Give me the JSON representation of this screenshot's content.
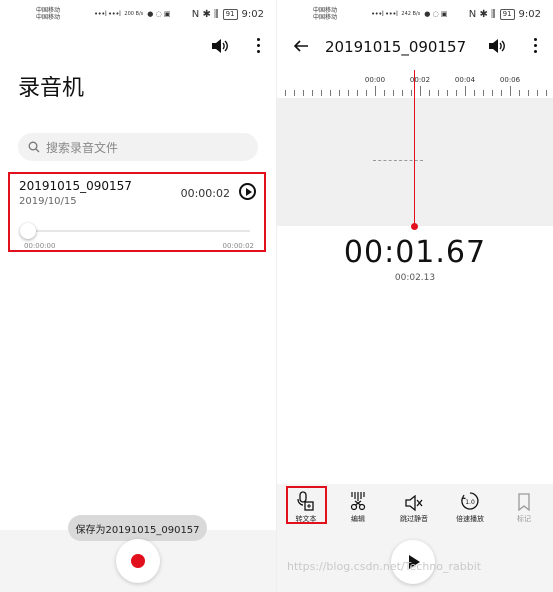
{
  "status_left": {
    "carrier_line1": "中国移动",
    "carrier_line2": "中国移动",
    "signal": "•••l •••l",
    "speed": "200 B/s",
    "time": "9:02",
    "battery": "91"
  },
  "status_right": {
    "carrier_line1": "中国移动",
    "carrier_line2": "中国移动",
    "signal": "•••l •••l",
    "speed": "242 B/s",
    "time": "9:02",
    "battery": "91"
  },
  "left": {
    "title": "录音机",
    "search_placeholder": "搜索录音文件",
    "recording": {
      "name": "20191015_090157",
      "date": "2019/10/15",
      "duration": "00:00:02",
      "time_start": "00:00:00",
      "time_end": "00:00:02",
      "progress": 0
    },
    "toast": "保存为20191015_090157"
  },
  "right": {
    "title": "20191015_090157",
    "ruler_labels": [
      "00:00",
      "00:02",
      "00:04",
      "00:06"
    ],
    "current_time": "00:01.67",
    "total_time": "00:02.13",
    "tools": [
      {
        "label": "转文本",
        "icon": "speech-to-text-icon"
      },
      {
        "label": "编辑",
        "icon": "edit-scissors-icon"
      },
      {
        "label": "跳过静音",
        "icon": "skip-silence-icon"
      },
      {
        "label": "倍速播放",
        "icon": "speed-1x-icon"
      },
      {
        "label": "标记",
        "icon": "bookmark-icon"
      }
    ],
    "speed_value": "1.0"
  },
  "watermark": "https://blog.csdn.net/Techno_rabbit",
  "colors": {
    "accent": "#e2101c",
    "background": "#ffffff",
    "panel_gray": "#f4f4f4"
  }
}
